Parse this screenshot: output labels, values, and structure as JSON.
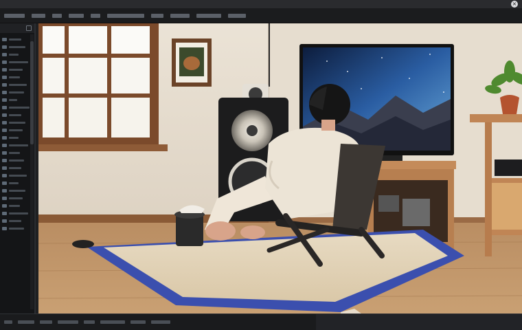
{
  "window": {
    "close_glyph": "×"
  },
  "menubar": {
    "items": []
  },
  "left_panel": {
    "rows": 26
  },
  "statusbar": {
    "items": []
  },
  "colors": {
    "accent": "#3b4fae",
    "chrome_bg": "#1b1c1e",
    "panel_bg": "#141517"
  },
  "icons": [
    "close-icon",
    "panel-toggle-icon"
  ]
}
